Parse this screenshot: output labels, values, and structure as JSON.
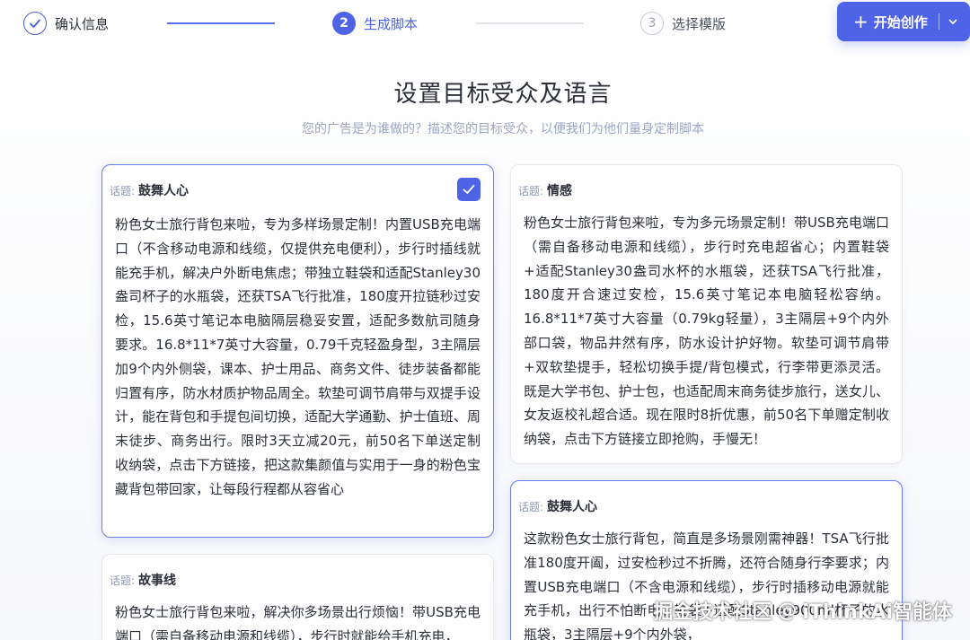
{
  "stepper": {
    "steps": [
      {
        "num": "",
        "label": "确认信息",
        "state": "done"
      },
      {
        "num": "2",
        "label": "生成脚本",
        "state": "active"
      },
      {
        "num": "3",
        "label": "选择模版",
        "state": "pending"
      }
    ]
  },
  "actions": {
    "start_label": "开始创作",
    "start_icon": "plus-icon",
    "dropdown_icon": "chevron-down-icon"
  },
  "header": {
    "title": "设置目标受众及语言",
    "subtitle": "您的广告是为谁做的？描述您的目标受众，以便我们为他们量身定制脚本"
  },
  "cards": [
    {
      "topic_prefix": "话题:",
      "topic": "鼓舞人心",
      "selected": true,
      "text": "粉色女士旅行背包来啦，专为多样场景定制！内置USB充电端口（不含移动电源和线缆，仅提供充电便利），步行时插线就能充手机，解决户外断电焦虑；带独立鞋袋和适配Stanley30盎司杯子的水瓶袋，还获TSA飞行批准，180度开拉链秒过安检，15.6英寸笔记本电脑隔层稳妥安置，适配多数航司随身要求。16.8*11*7英寸大容量，0.79千克轻盈身型，3主隔层加9个内外侧袋，课本、护士用品、商务文件、徒步装备都能归置有序，防水材质护物品周全。软垫可调节肩带与双提手设计，能在背包和手提包间切换，适配大学通勤、护士值班、周末徒步、商务出行。限时3天立减20元，前50名下单送定制收纳袋，点击下方链接，把这款集颜值与实用于一身的粉色宝藏背包带回家，让每段行程都从容省心"
    },
    {
      "topic_prefix": "话题:",
      "topic": "情感",
      "selected": false,
      "text": "粉色女士旅行背包来啦，专为多元场景定制！带USB充电端口（需自备移动电源和线缆），步行时充电超省心；内置鞋袋+适配Stanley30盎司水杯的水瓶袋，还获TSA飞行批准，180度开合速过安检，15.6英寸笔记本电脑轻松容纳。16.8*11*7英寸大容量（0.79kg轻量），3主隔层+9个内外部口袋，物品井然有序，防水设计护好物。软垫可调节肩带+双软垫提手，轻松切换手提/背包模式，行李带更添灵活。既是大学书包、护士包，也适配周末商务徒步旅行，送女儿、女友返校礼超合适。现在限时8折优惠，前50名下单赠定制收纳袋，点击下方链接立即抢购，手慢无！"
    },
    {
      "topic_prefix": "话题:",
      "topic": "鼓舞人心",
      "selected": false,
      "text": "这款粉色女士旅行背包，简直是多场景刚需神器！TSA飞行批准180度开阖，过安检秒过不折腾，还符合随身行李要求；内置USB充电端口（不含电源和线缆），步行时插移动电源就能充手机，出行不怕断电；鞋袋+适配Stanley900ml杯子的水瓶袋，3主隔层+9个内外袋，"
    },
    {
      "topic_prefix": "话题:",
      "topic": "故事线",
      "selected": false,
      "text": "粉色女士旅行背包来啦，解决你多场景出行烦恼！带USB充电端口（需自备移动电源和线缆），步行时就能给手机充电，"
    }
  ],
  "watermark": {
    "left": "掘金技术社区",
    "at": "@",
    "right": "iThinkAi智能体"
  }
}
